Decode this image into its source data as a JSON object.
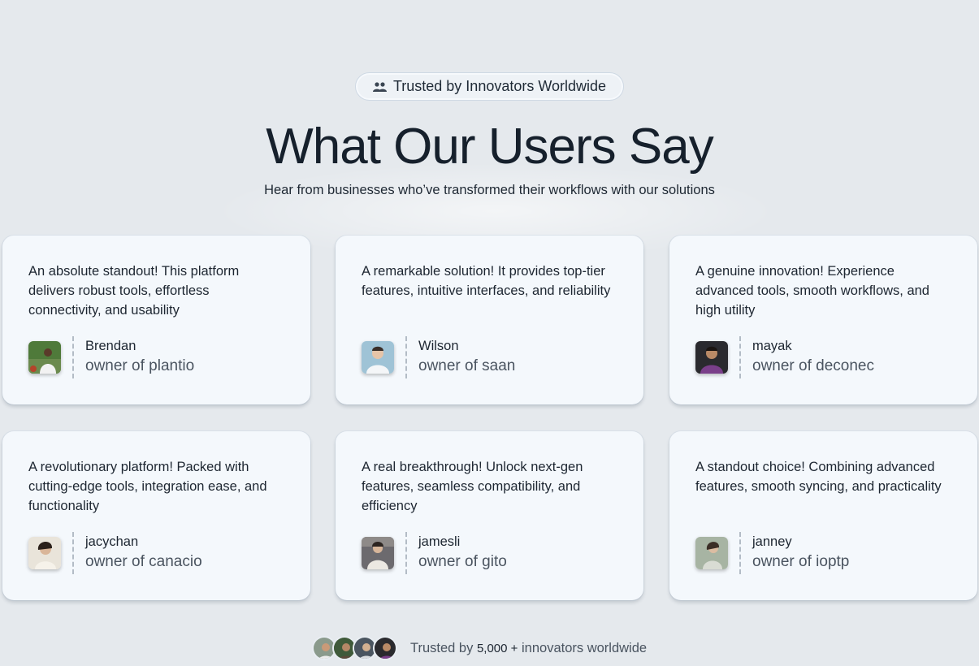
{
  "badge": {
    "icon": "users-icon",
    "label": "Trusted by Innovators Worldwide"
  },
  "heading": "What Our Users Say",
  "subheading": "Hear from businesses who’ve transformed their workflows with our solutions",
  "testimonials": [
    {
      "quote": "An absolute standout! This platform delivers robust tools, effortless connectivity, and usability",
      "name": "Brendan",
      "role": "owner of plantio",
      "avatar_bg": "#4f7a3a"
    },
    {
      "quote": "A remarkable solution! It provides top-tier features, intuitive interfaces, and reliability",
      "name": "Wilson",
      "role": "owner of saan",
      "avatar_bg": "#9fc3d6"
    },
    {
      "quote": "A genuine innovation! Experience advanced tools, smooth workflows, and high utility",
      "name": "mayak",
      "role": "owner of deconec",
      "avatar_bg": "#2a2a2e"
    },
    {
      "quote": "A revolutionary platform! Packed with cutting-edge tools, integration ease, and functionality",
      "name": "jacychan",
      "role": "owner of canacio",
      "avatar_bg": "#e9e4da"
    },
    {
      "quote": "A real breakthrough! Unlock next-gen features, seamless compatibility, and efficiency",
      "name": "jamesli",
      "role": "owner of gito",
      "avatar_bg": "#6c6a6e"
    },
    {
      "quote": "A standout choice! Combining advanced features, smooth syncing, and practicality",
      "name": "janney",
      "role": "owner of ioptp",
      "avatar_bg": "#a7b4a3"
    }
  ],
  "footer": {
    "prefix": "Trusted by",
    "count": "5,000 +",
    "suffix": "innovators worldwide"
  }
}
